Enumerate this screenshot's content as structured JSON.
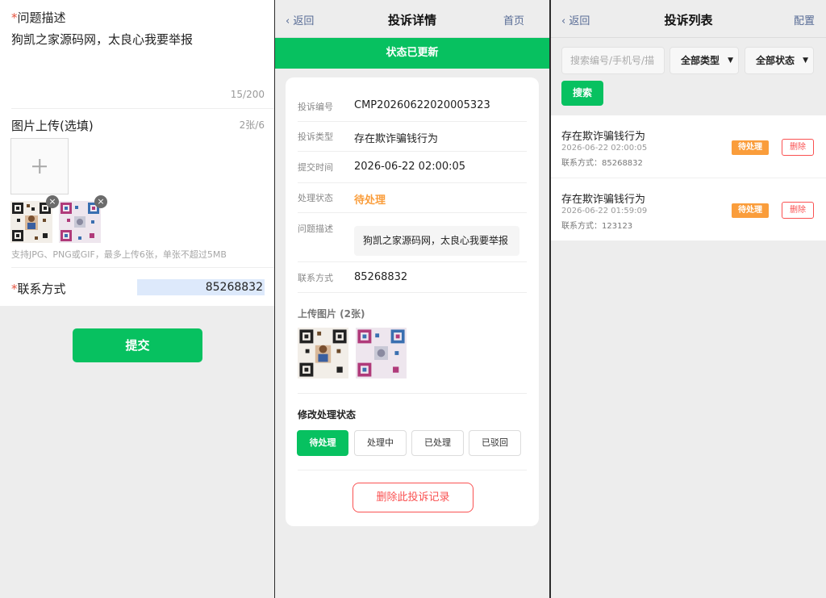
{
  "form": {
    "required_mark": "*",
    "desc_label": "问题描述",
    "desc_value": "狗凯之家源码网，太良心我要举报",
    "desc_counter": "15/200",
    "upload_label": "图片上传(选填)",
    "upload_count": "2张/6",
    "upload_tip": "支持JPG、PNG或GIF，最多上传6张，单张不超过5MB",
    "contact_label": "联系方式",
    "contact_value": "85268832",
    "submit_label": "提交",
    "remove_glyph": "×"
  },
  "detail": {
    "back_label": "‹ 返回",
    "title": "投诉详情",
    "home_label": "首页",
    "banner": "状态已更新",
    "rows": {
      "id_key": "投诉编号",
      "id_val": "CMP20260622020005323",
      "type_key": "投诉类型",
      "type_val": "存在欺诈骗钱行为",
      "time_key": "提交时间",
      "time_val": "2026-06-22 02:00:05",
      "status_key": "处理状态",
      "status_val": "待处理",
      "desc_key": "问题描述",
      "desc_val": "狗凯之家源码网，太良心我要举报",
      "contact_key": "联系方式",
      "contact_val": "85268832"
    },
    "images_title": "上传图片 (2张)",
    "modify_title": "修改处理状态",
    "status_buttons": [
      "待处理",
      "处理中",
      "已处理",
      "已驳回"
    ],
    "delete_label": "删除此投诉记录"
  },
  "list": {
    "back_label": "‹ 返回",
    "title": "投诉列表",
    "config_label": "配置",
    "search_placeholder": "搜索编号/手机号/描",
    "type_filter": "全部类型",
    "status_filter": "全部状态",
    "search_label": "搜索",
    "items": [
      {
        "title": "存在欺诈骗钱行为",
        "time": "2026-06-22 02:00:05",
        "contact": "联系方式：85268832",
        "badge": "待处理",
        "delete": "删除"
      },
      {
        "title": "存在欺诈骗钱行为",
        "time": "2026-06-22 01:59:09",
        "contact": "联系方式：123123",
        "badge": "待处理",
        "delete": "删除"
      }
    ]
  },
  "colors": {
    "accent": "#07c160",
    "pending": "#fa9d3b",
    "danger": "#fa5151",
    "link": "#576b95"
  },
  "icons": [
    "plus-icon",
    "close-icon",
    "chevron-down-icon",
    "back-chevron-icon"
  ]
}
